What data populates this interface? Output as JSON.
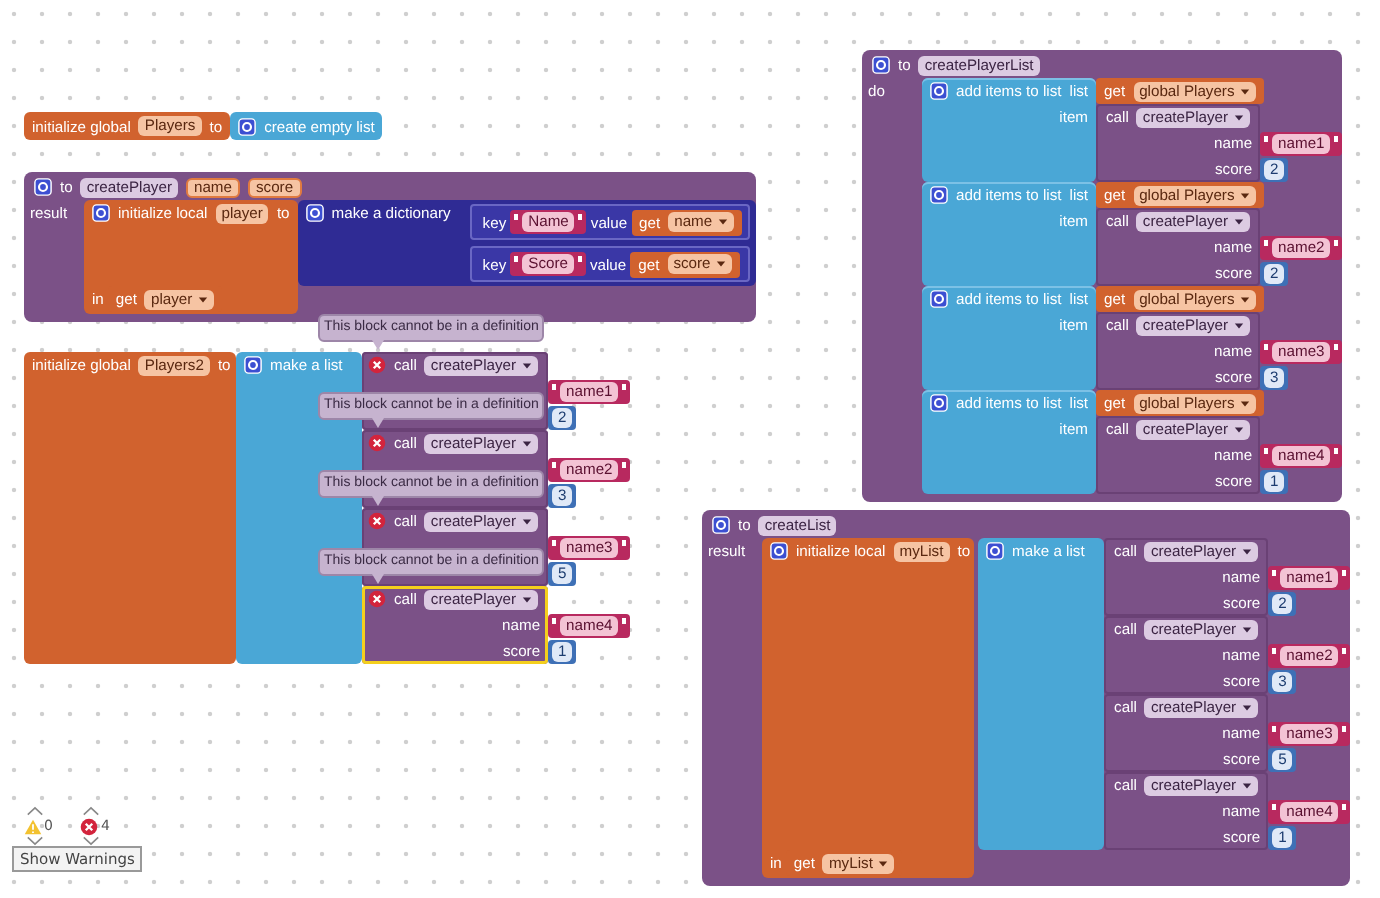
{
  "global_players": {
    "label": "initialize global",
    "name": "Players",
    "to": "to",
    "value_label": "create empty list"
  },
  "create_player": {
    "to": "to",
    "name": "createPlayer",
    "params": [
      "name",
      "score"
    ],
    "result": "result",
    "local": {
      "label": "initialize local",
      "name": "player",
      "to": "to",
      "in": "in",
      "get": "get",
      "get_var": "player"
    },
    "dictionary": {
      "label": "make a dictionary",
      "pairs": [
        {
          "key": "key",
          "key_text": "Name",
          "value": "value",
          "get": "get",
          "var": "name"
        },
        {
          "key": "key",
          "key_text": "Score",
          "value": "value",
          "get": "get",
          "var": "score"
        }
      ]
    }
  },
  "players2": {
    "label": "initialize global",
    "name": "Players2",
    "to": "to",
    "list_label": "make a list",
    "calls": [
      {
        "error": true,
        "warning": "This block cannot be in a definition",
        "call": "call",
        "proc": "createPlayer",
        "selected": false,
        "args": [
          {
            "kind": "text",
            "value": "name1"
          },
          {
            "kind": "number",
            "value": "2"
          }
        ]
      },
      {
        "error": true,
        "warning": "This block cannot be in a definition",
        "call": "call",
        "proc": "createPlayer",
        "selected": false,
        "args": [
          {
            "kind": "text",
            "value": "name2"
          },
          {
            "kind": "number",
            "value": "3"
          }
        ]
      },
      {
        "error": true,
        "warning": "This block cannot be in a definition",
        "call": "call",
        "proc": "createPlayer",
        "selected": false,
        "args": [
          {
            "kind": "text",
            "value": "name3"
          },
          {
            "kind": "number",
            "value": "5"
          }
        ]
      },
      {
        "error": true,
        "warning": "This block cannot be in a definition",
        "call": "call",
        "proc": "createPlayer",
        "selected": true,
        "args": [
          {
            "kind": "text",
            "label": "name",
            "value": "name4"
          },
          {
            "kind": "number",
            "label": "score",
            "value": "1"
          }
        ]
      }
    ]
  },
  "create_player_list": {
    "to": "to",
    "name": "createPlayerList",
    "do": "do",
    "items": [
      {
        "label": "add items to list",
        "list": "list",
        "get": "get",
        "var": "global Players",
        "item": "item",
        "call": {
          "call": "call",
          "proc": "createPlayer",
          "selected": false,
          "args": [
            {
              "kind": "text",
              "label": "name",
              "value": "name1"
            },
            {
              "kind": "number",
              "label": "score",
              "value": "2"
            }
          ]
        }
      },
      {
        "label": "add items to list",
        "list": "list",
        "get": "get",
        "var": "global Players",
        "item": "item",
        "call": {
          "call": "call",
          "proc": "createPlayer",
          "selected": false,
          "args": [
            {
              "kind": "text",
              "label": "name",
              "value": "name2"
            },
            {
              "kind": "number",
              "label": "score",
              "value": "2"
            }
          ]
        }
      },
      {
        "label": "add items to list",
        "list": "list",
        "get": "get",
        "var": "global Players",
        "item": "item",
        "call": {
          "call": "call",
          "proc": "createPlayer",
          "selected": false,
          "args": [
            {
              "kind": "text",
              "label": "name",
              "value": "name3"
            },
            {
              "kind": "number",
              "label": "score",
              "value": "3"
            }
          ]
        }
      },
      {
        "label": "add items to list",
        "list": "list",
        "get": "get",
        "var": "global Players",
        "item": "item",
        "call": {
          "call": "call",
          "proc": "createPlayer",
          "selected": false,
          "args": [
            {
              "kind": "text",
              "label": "name",
              "value": "name4"
            },
            {
              "kind": "number",
              "label": "score",
              "value": "1"
            }
          ]
        }
      }
    ]
  },
  "create_list": {
    "to": "to",
    "name": "createList",
    "result": "result",
    "local": {
      "label": "initialize local",
      "name": "myList",
      "to": "to",
      "in": "in",
      "get": "get",
      "get_var": "myList"
    },
    "list_label": "make a list",
    "calls": [
      {
        "call": "call",
        "proc": "createPlayer",
        "selected": false,
        "args": [
          {
            "kind": "text",
            "label": "name",
            "value": "name1"
          },
          {
            "kind": "number",
            "label": "score",
            "value": "2"
          }
        ]
      },
      {
        "call": "call",
        "proc": "createPlayer",
        "selected": false,
        "args": [
          {
            "kind": "text",
            "label": "name",
            "value": "name2"
          },
          {
            "kind": "number",
            "label": "score",
            "value": "3"
          }
        ]
      },
      {
        "call": "call",
        "proc": "createPlayer",
        "selected": false,
        "args": [
          {
            "kind": "text",
            "label": "name",
            "value": "name3"
          },
          {
            "kind": "number",
            "label": "score",
            "value": "5"
          }
        ]
      },
      {
        "call": "call",
        "proc": "createPlayer",
        "selected": false,
        "args": [
          {
            "kind": "text",
            "label": "name",
            "value": "name4"
          },
          {
            "kind": "number",
            "label": "score",
            "value": "1"
          }
        ]
      }
    ]
  },
  "warnings": {
    "warning_count": "0",
    "error_count": "4",
    "button": "Show Warnings"
  }
}
